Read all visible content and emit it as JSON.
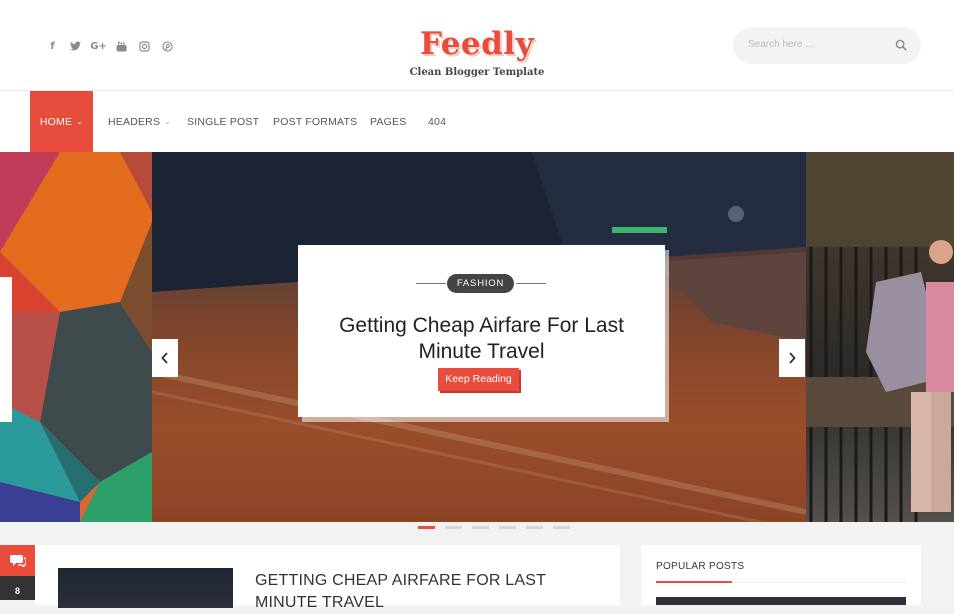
{
  "header": {
    "social_icons": [
      "facebook-icon",
      "twitter-icon",
      "google-plus-icon",
      "youtube-icon",
      "instagram-icon",
      "pinterest-icon"
    ],
    "social_glyphs": [
      "f",
      "t",
      "G+",
      "▶",
      "◎",
      "℗"
    ],
    "logo_title": "Feedly",
    "logo_tagline": "Clean Blogger Template",
    "search_placeholder": "Search here ..."
  },
  "nav": {
    "items": [
      {
        "label": "HOME",
        "has_dropdown": true,
        "active": true
      },
      {
        "label": "HEADERS",
        "has_dropdown": true,
        "active": false
      },
      {
        "label": "SINGLE POST",
        "has_dropdown": false,
        "active": false
      },
      {
        "label": "POST FORMATS",
        "has_dropdown": false,
        "active": false
      },
      {
        "label": "PAGES",
        "has_dropdown": false,
        "active": false
      },
      {
        "label": "404",
        "has_dropdown": false,
        "active": false
      }
    ]
  },
  "slider": {
    "category": "FASHION",
    "headline": "Getting Cheap Airfare For Last Minute Travel",
    "button_label": "Keep Reading",
    "slide_count": 6,
    "active_slide": 1
  },
  "post": {
    "comment_count": "8",
    "title": "GETTING CHEAP AIRFARE FOR LAST MINUTE TRAVEL"
  },
  "sidebar": {
    "widget_title": "POPULAR POSTS"
  },
  "colors": {
    "accent": "#e84c3d",
    "dark": "#333333",
    "background": "#f2f2f2"
  }
}
